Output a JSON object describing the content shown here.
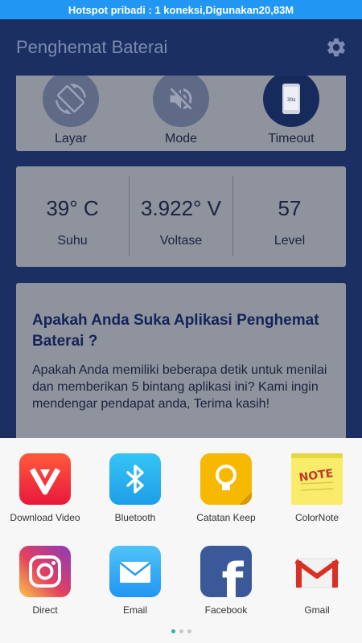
{
  "status_bar": {
    "text": "Hotspot pribadi : 1 koneksi,Digunakan20,83M"
  },
  "app_bar": {
    "title": "Penghemat Baterai"
  },
  "modes": [
    {
      "label": "Layar",
      "icon": "screen-rotation-icon"
    },
    {
      "label": "Mode",
      "icon": "volume-off-icon"
    },
    {
      "label": "Timeout",
      "icon": "phone-timeout-icon",
      "icon_text": "30s"
    }
  ],
  "stats": [
    {
      "value": "39° C",
      "label": "Suhu"
    },
    {
      "value": "3.922° V",
      "label": "Voltase"
    },
    {
      "value": "57",
      "label": "Level"
    }
  ],
  "rate_card": {
    "title": "Apakah Anda Suka Aplikasi Penghemat Baterai ?",
    "body": "Apakah Anda memiliki beberapa detik untuk menilai dan memberikan 5 bintang aplikasi ini? Kami ingin mendengar pendapat anda, Terima kasih!"
  },
  "share_apps": [
    {
      "label": "Download Video",
      "icon": "vidmate-icon"
    },
    {
      "label": "Bluetooth",
      "icon": "bluetooth-icon"
    },
    {
      "label": "Catatan Keep",
      "icon": "keep-notes-icon"
    },
    {
      "label": "ColorNote",
      "icon": "colornote-icon",
      "icon_text": "NOTE"
    },
    {
      "label": "Direct",
      "icon": "instagram-direct-icon"
    },
    {
      "label": "Email",
      "icon": "email-icon"
    },
    {
      "label": "Facebook",
      "icon": "facebook-icon",
      "icon_text": "f"
    },
    {
      "label": "Gmail",
      "icon": "gmail-icon"
    }
  ],
  "colors": {
    "header_bg": "#1b2f63",
    "status_bar": "#2196f3",
    "card_bg": "#8f939d",
    "accent_dot": "#2db3a0"
  }
}
